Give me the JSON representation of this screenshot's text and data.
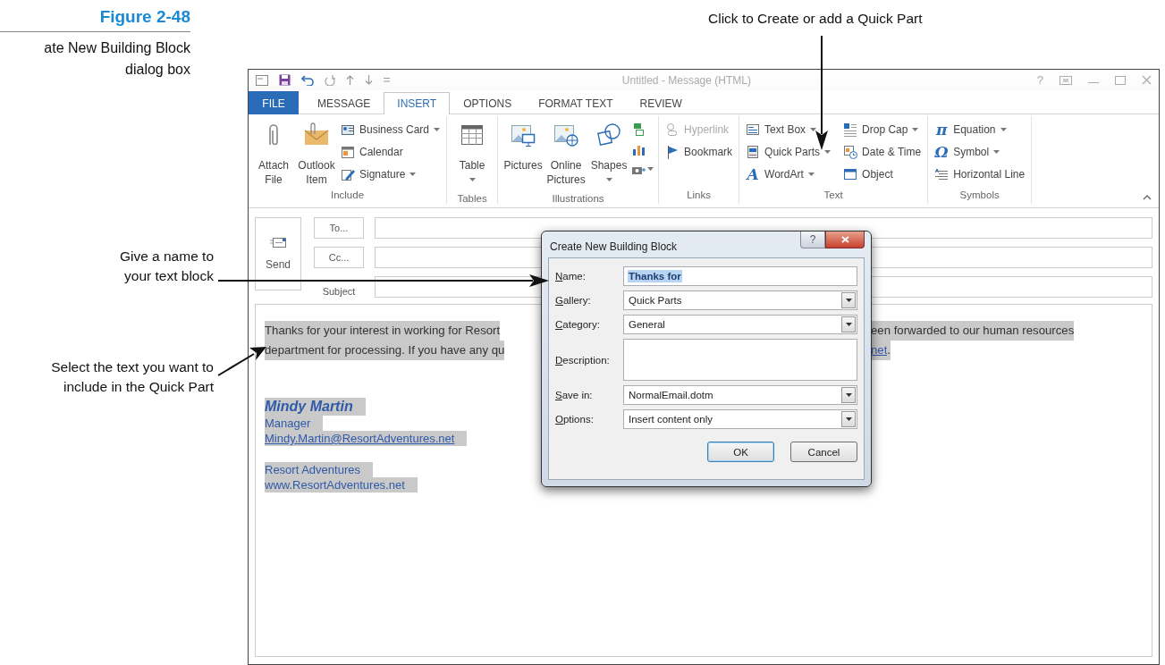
{
  "figure": {
    "label": "Figure 2-48",
    "caption": "ate New Building Block dialog box"
  },
  "callouts": [
    {
      "text": "Click to Create or add a Quick Part"
    },
    {
      "text": "Give a name to your text block"
    },
    {
      "text": "Select the text you want to include in the Quick Part"
    }
  ],
  "window": {
    "title": "Untitled - Message (HTML)",
    "help": "?"
  },
  "tabs": [
    {
      "label": "FILE",
      "kind": "file",
      "selected": false
    },
    {
      "label": "MESSAGE",
      "kind": "tab",
      "selected": false
    },
    {
      "label": "INSERT",
      "kind": "tab",
      "selected": true
    },
    {
      "label": "OPTIONS",
      "kind": "tab",
      "selected": false
    },
    {
      "label": "FORMAT TEXT",
      "kind": "tab",
      "selected": false
    },
    {
      "label": "REVIEW",
      "kind": "tab",
      "selected": false
    }
  ],
  "ribbon": {
    "groups": [
      {
        "label": "Include",
        "large": [
          {
            "label": "Attach File",
            "dropdown": false
          },
          {
            "label": "Outlook Item",
            "dropdown": false
          }
        ],
        "small": [
          {
            "label": "Business Card",
            "dropdown": true,
            "disabled": false
          },
          {
            "label": "Calendar",
            "dropdown": false,
            "disabled": false
          },
          {
            "label": "Signature",
            "dropdown": true,
            "disabled": false
          }
        ]
      },
      {
        "label": "Tables",
        "large": [
          {
            "label": "Table",
            "dropdown": true
          }
        ]
      },
      {
        "label": "Illustrations",
        "large": [
          {
            "label": "Pictures",
            "dropdown": false
          },
          {
            "label": "Online Pictures",
            "dropdown": false
          },
          {
            "label": "Shapes",
            "dropdown": true
          }
        ]
      },
      {
        "label": "Links",
        "small": [
          {
            "label": "Hyperlink",
            "dropdown": false,
            "disabled": true
          },
          {
            "label": "Bookmark",
            "dropdown": false,
            "disabled": false
          }
        ]
      },
      {
        "label": "Text",
        "small": [
          {
            "label": "Text Box",
            "dropdown": true,
            "disabled": false
          },
          {
            "label": "Quick Parts",
            "dropdown": true,
            "disabled": false
          },
          {
            "label": "WordArt",
            "glyph": "A",
            "dropdown": true,
            "disabled": false
          },
          {
            "label": "Drop Cap",
            "dropdown": true,
            "disabled": false
          },
          {
            "label": "Date & Time",
            "dropdown": false,
            "disabled": false
          },
          {
            "label": "Object",
            "dropdown": false,
            "disabled": false
          }
        ]
      },
      {
        "label": "Symbols",
        "small": [
          {
            "label": "Equation",
            "glyph": "π",
            "dropdown": true,
            "disabled": false
          },
          {
            "label": "Symbol",
            "glyph": "Ω",
            "dropdown": true,
            "disabled": false
          },
          {
            "label": "Horizontal Line",
            "dropdown": false,
            "disabled": false
          }
        ]
      }
    ]
  },
  "message": {
    "send": "Send",
    "to": "To...",
    "cc": "Cc...",
    "subject_label": "Subject",
    "body": {
      "selected": true,
      "lines": [
        {
          "left": "Thanks for your interest in working for Resort",
          "right": [
            {
              "text": "een forwarded to our human resources",
              "link": false
            }
          ]
        },
        {
          "left": "department for processing. If you have any qu",
          "right": [
            {
              "text": "net",
              "link": true
            },
            {
              "text": ".",
              "link": false
            }
          ]
        }
      ],
      "signature": [
        {
          "lines": [
            {
              "text": "Mindy Martin",
              "kind": "name"
            },
            {
              "text": "Manager",
              "kind": "text"
            },
            {
              "text": "Mindy.Martin@ResortAdventures.net",
              "kind": "link"
            }
          ]
        },
        {
          "lines": [
            {
              "text": "Resort Adventures",
              "kind": "text"
            },
            {
              "text": "www.ResortAdventures.net",
              "kind": "text"
            }
          ]
        }
      ]
    }
  },
  "dialog": {
    "title": "Create New Building Block",
    "help": "?",
    "fields": [
      {
        "label": "Name:",
        "kind": "text",
        "value": "Thanks for",
        "text_selected": true
      },
      {
        "label": "Gallery:",
        "kind": "dropdown",
        "value": "Quick Parts",
        "text_selected": false
      },
      {
        "label": "Category:",
        "kind": "dropdown",
        "value": "General",
        "text_selected": false
      },
      {
        "label": "Description:",
        "kind": "textarea"
      },
      {
        "label": "Save in:",
        "kind": "dropdown",
        "value": "NormalEmail.dotm",
        "text_selected": false
      },
      {
        "label": "Options:",
        "kind": "dropdown",
        "value": "Insert content only",
        "text_selected": false
      }
    ],
    "buttons": [
      {
        "label": "OK",
        "default": true
      },
      {
        "label": "Cancel",
        "default": false
      }
    ]
  }
}
